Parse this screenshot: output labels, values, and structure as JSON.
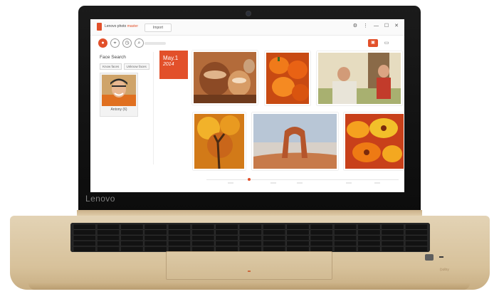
{
  "bezel": {
    "brand": "Lenovo"
  },
  "app": {
    "title_prefix": "Lenovo photo",
    "title_accent": "master",
    "import_label": "Import",
    "window_controls": [
      "⚙",
      "⋮",
      "—",
      "☐",
      "✕"
    ],
    "accent_color": "#e2502a"
  },
  "nav": {
    "icons": [
      "person-icon",
      "location-icon",
      "clock-icon",
      "search-icon"
    ]
  },
  "face_search": {
    "title": "Face Search",
    "tabs": [
      "Know faces",
      "Unknow faces"
    ],
    "person": {
      "name": "Antony",
      "count": "(6)"
    }
  },
  "timeline": {
    "date_day": "May.1",
    "date_year": "2014"
  },
  "photos": [
    "pottery-photo",
    "peppers-photo",
    "father-son-photo",
    "autumn-tree-photo",
    "arch-photo",
    "orange-flowers-photo"
  ],
  "base": {
    "badge": "Dolby"
  }
}
